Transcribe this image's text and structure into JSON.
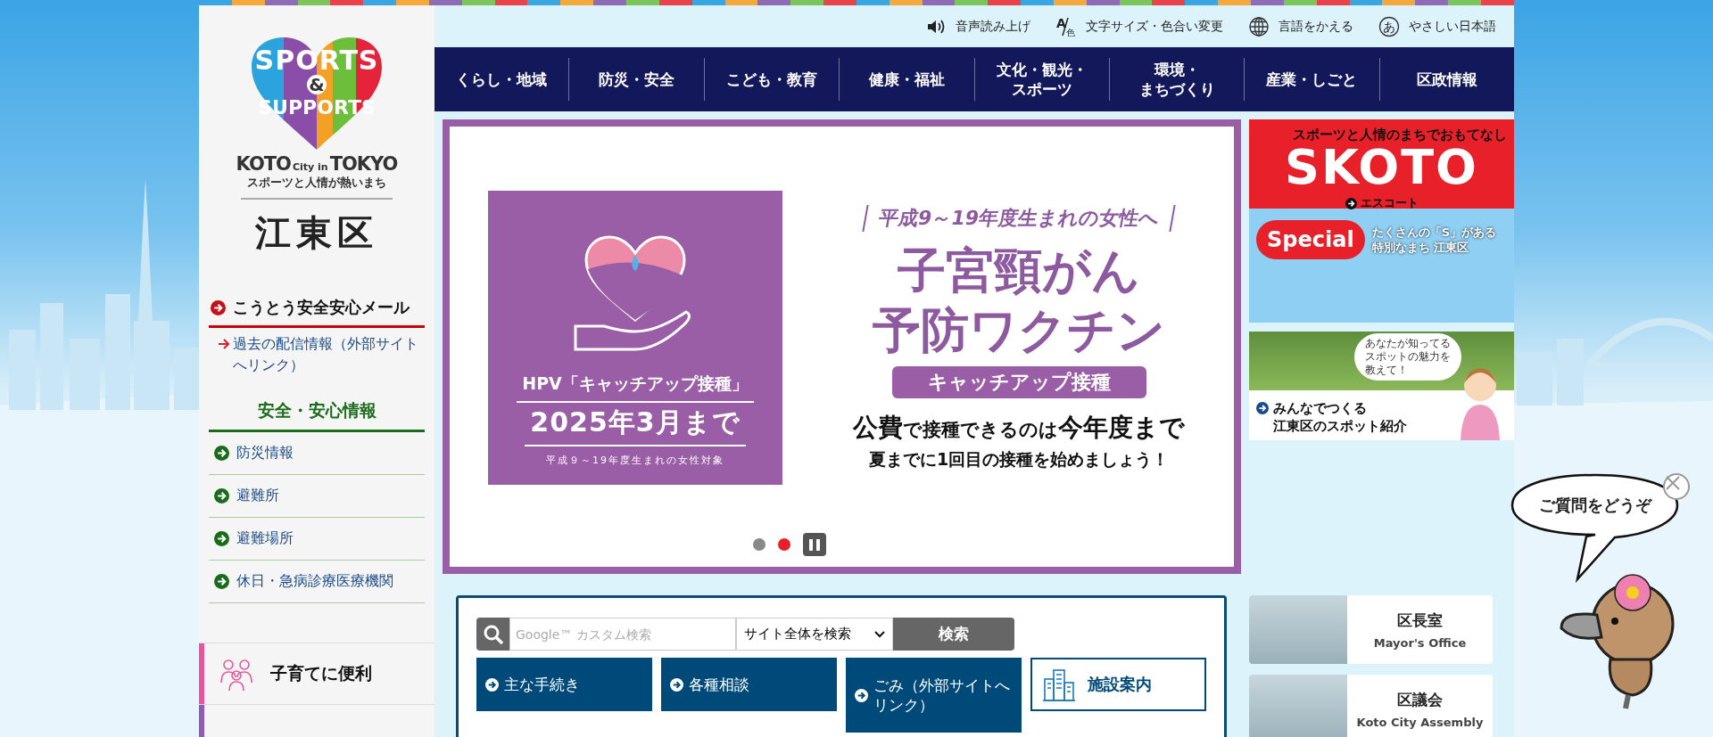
{
  "logo": {
    "heart_top": "SPORTS",
    "heart_mid": "&",
    "heart_bottom": "SUPPORTS",
    "en_left": "KOTO",
    "en_mid": "City in",
    "en_right": "TOKYO",
    "tagline": "スポーツと人情が熱いまち",
    "ward_name": "江東区"
  },
  "sidebar": {
    "mail": {
      "title": "こうとう安全安心メール",
      "link": "過去の配信情報（外部サイトへリンク）"
    },
    "safety": {
      "heading": "安全・安心情報",
      "items": [
        "防災情報",
        "避難所",
        "避難場所",
        "休日・急病診療医療機関"
      ]
    },
    "categories": [
      {
        "label": "子育てに便利",
        "color": "#e8559a"
      },
      {
        "color": "#8e5bb5"
      }
    ]
  },
  "utility": [
    {
      "label": "音声読み上げ"
    },
    {
      "glyphs": [
        "A",
        "色"
      ],
      "label": "文字サイズ・色合い変更"
    },
    {
      "label": "言語をかえる"
    },
    {
      "glyph": "あ",
      "label": "やさしい日本語"
    }
  ],
  "nav": [
    [
      "くらし・地域"
    ],
    [
      "防災・安全"
    ],
    [
      "こども・教育"
    ],
    [
      "健康・福祉"
    ],
    [
      "文化・観光・",
      "スポーツ"
    ],
    [
      "環境・",
      "まちづくり"
    ],
    [
      "産業・しごと"
    ],
    [
      "区政情報"
    ]
  ],
  "banner": {
    "lead": "HPV「キャッチアップ接種」",
    "deadline": "2025年3月まで",
    "note": "平成９～19年度生まれの女性対象",
    "audience": "平成9～19年度生まれの女性へ",
    "title": [
      "子宮頸がん",
      "予防ワクチン"
    ],
    "tag": "キャッチアップ接種",
    "message": "**公費**で接種できるのは**今年度まで**",
    "sub": "夏までに1回目の接種を始めましょう！",
    "indicators": [
      {
        "selected": false
      },
      {
        "selected": true
      }
    ]
  },
  "side_banners": {
    "skoto": {
      "tagline": "スポーツと人情のまちでおもてなし",
      "logo": "SKOTO",
      "link": "エスコート",
      "special": "Special",
      "caption": [
        "たくさんの「S」がある",
        "特別なまち 江東区"
      ]
    },
    "spot": {
      "bubble": [
        "あなたが知ってる",
        "スポットの魅力を",
        "教えて！"
      ],
      "link": [
        "みんなでつくる",
        "江東区のスポット紹介"
      ]
    }
  },
  "search": {
    "placeholder": "Google™ カスタム検索",
    "scope": "サイト全体を検索",
    "button": "検索",
    "tiles": [
      {
        "kind": "link",
        "label": "主な手続き"
      },
      {
        "kind": "link",
        "label": "各種相談"
      },
      {
        "kind": "link",
        "label": "ごみ（外部サイトへリンク）"
      },
      {
        "kind": "facility",
        "label": "施設案内"
      }
    ]
  },
  "office_cards": [
    {
      "title": "区長室",
      "subtitle": "Mayor's Office"
    },
    {
      "title": "区議会",
      "subtitle": "Koto City Assembly"
    }
  ],
  "chat": {
    "bubble": "ご質問をどうぞ"
  }
}
